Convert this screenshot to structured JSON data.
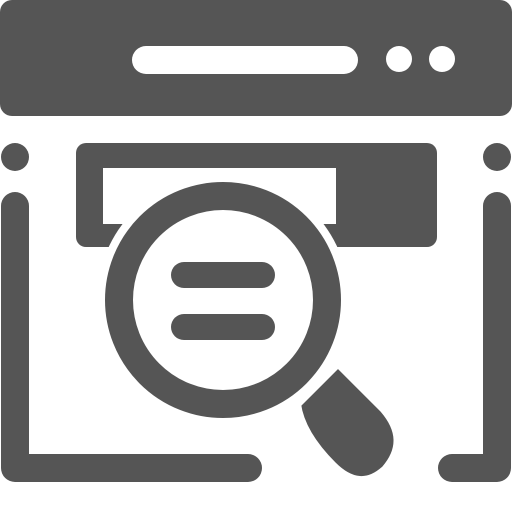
{
  "icon": {
    "name": "web-search-icon",
    "color": "#555555",
    "background": "#ffffff",
    "parts": [
      "browser-title-bar",
      "address-bar",
      "window-control-dots",
      "browser-frame",
      "search-field",
      "magnifying-glass",
      "lens-lines",
      "magnifier-handle"
    ]
  }
}
